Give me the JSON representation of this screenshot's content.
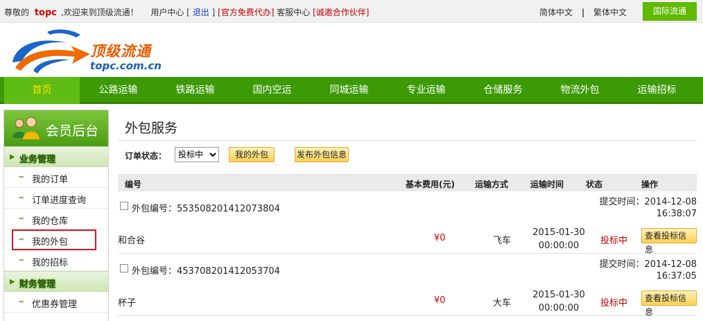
{
  "topbar": {
    "greeting_prefix": "尊敬的",
    "username": "topc",
    "welcome": ",欢迎来到顶级流通！",
    "user_center": "用户中心",
    "bracket_open": "[",
    "bracket_close": "]",
    "logout": "退出",
    "free_agent": "[官方免费代办]",
    "customer_service": "客服中心",
    "partner": "[诚邀合作伙伴]",
    "simplified": "简体中文",
    "separator": "|",
    "traditional": "繁体中文",
    "international": "国际流通"
  },
  "logo": {
    "brand": "顶级流通",
    "domain": "topc.com.cn"
  },
  "nav": {
    "items": [
      {
        "label": "首页"
      },
      {
        "label": "公路运输"
      },
      {
        "label": "铁路运输"
      },
      {
        "label": "国内空运"
      },
      {
        "label": "同城运输"
      },
      {
        "label": "专业运输"
      },
      {
        "label": "仓储服务"
      },
      {
        "label": "物流外包"
      },
      {
        "label": "运输招标"
      }
    ]
  },
  "sidebar": {
    "title": "会员后台",
    "business_section": "业务管理",
    "business_items": [
      {
        "label": "我的订单"
      },
      {
        "label": "订单进度查询"
      },
      {
        "label": "我的仓库"
      },
      {
        "label": "我的外包"
      },
      {
        "label": "我的招标"
      }
    ],
    "finance_section": "财务管理",
    "finance_items": [
      {
        "label": "优惠券管理"
      }
    ]
  },
  "main": {
    "title": "外包服务",
    "filter_label": "订单状态：",
    "status_selected": "投标中",
    "my_outsource_button": "我的外包",
    "publish_button": "发布外包信息",
    "columns": {
      "no": "编号",
      "fee": "基本费用(元)",
      "transport": "运输方式",
      "time": "运输时间",
      "status": "状态",
      "action": "操作"
    },
    "orders": [
      {
        "no": "外包编号：553508201412073804",
        "submit_line1": "提交时间：2014-12-08",
        "submit_line2": "16:38:07",
        "name": "和合谷",
        "fee": "¥0",
        "transport": "飞车",
        "time_date": "2015-01-30",
        "time_clock": "00:00:00",
        "status": "投标中",
        "action": "查看投标信息"
      },
      {
        "no": "外包编号：453708201412053704",
        "submit_line1": "提交时间：2014-12-08",
        "submit_line2": "16:37:05",
        "name": "杯子",
        "fee": "¥0",
        "transport": "大车",
        "time_date": "2015-01-30",
        "time_clock": "00:00:00",
        "status": "投标中",
        "action": "查看投标信息"
      }
    ]
  },
  "colors": {
    "nav_green": "#3c9a06",
    "nav_active_text": "#ffe300",
    "accent_red": "#d40000",
    "button_yellow": "#ffcf55",
    "highlight_box": "#e0141e"
  }
}
